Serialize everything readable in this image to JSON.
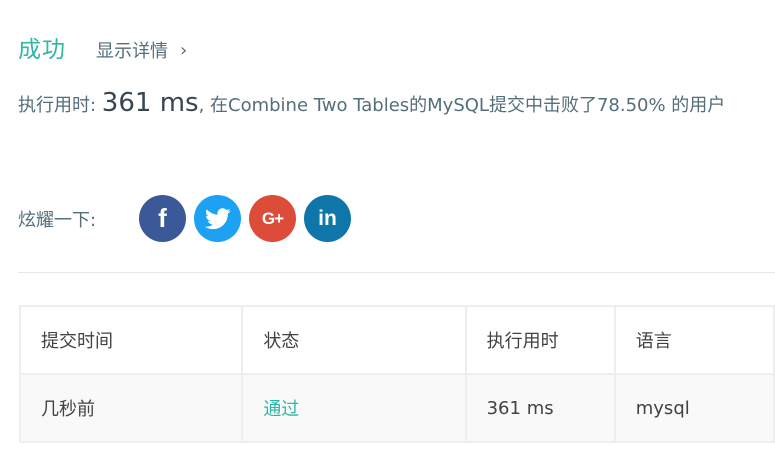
{
  "result": {
    "status": "成功",
    "details_link": "显示详情",
    "details_chevron": "›"
  },
  "runtime": {
    "prefix": "执行用时: ",
    "value": "361 ms",
    "suffix": ", 在Combine Two Tables的MySQL提交中击败了78.50% 的用户"
  },
  "share": {
    "label": "炫耀一下:",
    "buttons": [
      {
        "name": "facebook",
        "glyph": "f",
        "color": "#3b5998"
      },
      {
        "name": "twitter",
        "glyph": "",
        "color": "#1da1f2"
      },
      {
        "name": "google-plus",
        "glyph": "G+",
        "color": "#dd4b39"
      },
      {
        "name": "linkedin",
        "glyph": "in",
        "color": "#0e76a8"
      }
    ]
  },
  "table": {
    "headers": [
      "提交时间",
      "状态",
      "执行用时",
      "语言"
    ],
    "rows": [
      {
        "time": "几秒前",
        "status": "通过",
        "runtime": "361 ms",
        "language": "mysql"
      }
    ]
  },
  "colors": {
    "accent": "#2db7a4",
    "text": "#546e7a"
  }
}
